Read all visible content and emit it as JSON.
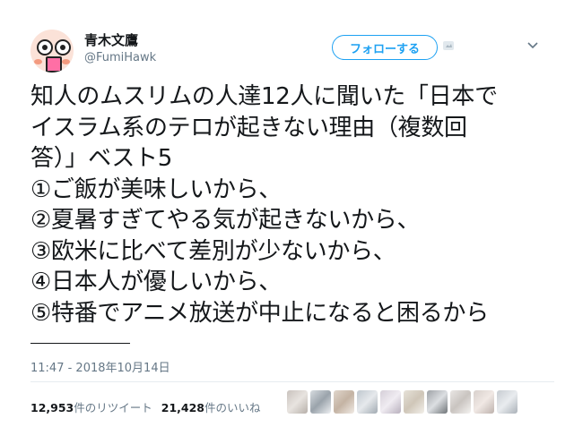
{
  "user": {
    "display_name": "青木文鷹",
    "handle": "@FumiHawk"
  },
  "follow_button": {
    "label": "フォローする"
  },
  "icons": [
    "avatar-face",
    "twitter-logo-icon",
    "chevron-down-icon"
  ],
  "tweet": {
    "lines": [
      "知人のムスリムの人達12人に聞いた「日本で",
      "イスラム系のテロが起きない理由（複数回",
      "答）」ベスト5",
      "①ご飯が美味しいから、",
      "②夏暑すぎてやる気が起きないから、",
      "③欧米に比べて差別が少ないから、",
      "④日本人が優しいから、",
      "⑤特番でアニメ放送が中止になると困るから"
    ]
  },
  "timestamp": "11:47 - 2018年10月14日",
  "stats": {
    "retweets_count": "12,953",
    "retweets_label": "件のリツイート",
    "likes_count": "21,428",
    "likes_label": "件のいいね"
  },
  "colors": {
    "accent": "#1da1f2",
    "text": "#14171a",
    "muted": "#657786",
    "divider": "#e6ecf0"
  }
}
